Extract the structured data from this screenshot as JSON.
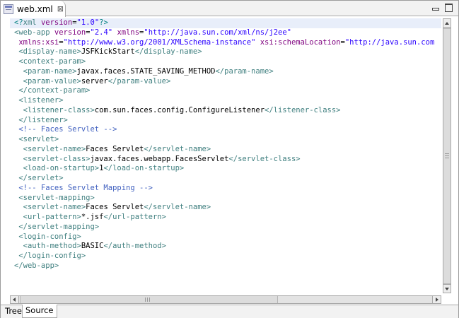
{
  "editor_tab": {
    "title": "web.xml",
    "close_glyph": "⊠",
    "icon": "xml-file-icon"
  },
  "window_controls": {
    "minimize": "minimize-icon",
    "maximize": "maximize-icon"
  },
  "code_lines": [
    [
      [
        "pi",
        "<?"
      ],
      [
        "t",
        "xml "
      ],
      [
        "a",
        "version"
      ],
      [
        "txt",
        "="
      ],
      [
        "v",
        "\"1.0\""
      ],
      [
        "pi",
        "?>"
      ]
    ],
    [
      [
        "t",
        "<web-app "
      ],
      [
        "a",
        "version"
      ],
      [
        "txt",
        "="
      ],
      [
        "v",
        "\"2.4\""
      ],
      [
        "txt",
        " "
      ],
      [
        "a",
        "xmlns"
      ],
      [
        "txt",
        "="
      ],
      [
        "v",
        "\"http://java.sun.com/xml/ns/j2ee\""
      ]
    ],
    [
      [
        "txt",
        " "
      ],
      [
        "a",
        "xmlns:xsi"
      ],
      [
        "txt",
        "="
      ],
      [
        "v",
        "\"http://www.w3.org/2001/XMLSchema-instance\""
      ],
      [
        "txt",
        " "
      ],
      [
        "a",
        "xsi:schemaLocation"
      ],
      [
        "txt",
        "="
      ],
      [
        "v",
        "\"http://java.sun.com"
      ]
    ],
    [
      [
        "t",
        " <display-name>"
      ],
      [
        "txt",
        "JSFKickStart"
      ],
      [
        "t",
        "</display-name>"
      ]
    ],
    [
      [
        "t",
        " <context-param>"
      ]
    ],
    [
      [
        "t",
        "  <param-name>"
      ],
      [
        "txt",
        "javax.faces.STATE_SAVING_METHOD"
      ],
      [
        "t",
        "</param-name>"
      ]
    ],
    [
      [
        "t",
        "  <param-value>"
      ],
      [
        "txt",
        "server"
      ],
      [
        "t",
        "</param-value>"
      ]
    ],
    [
      [
        "t",
        " </context-param>"
      ]
    ],
    [
      [
        "t",
        " <listener>"
      ]
    ],
    [
      [
        "t",
        "  <listener-class>"
      ],
      [
        "txt",
        "com.sun.faces.config.ConfigureListener"
      ],
      [
        "t",
        "</listener-class>"
      ]
    ],
    [
      [
        "t",
        " </listener>"
      ]
    ],
    [
      [
        "c",
        " <!-- Faces Servlet -->"
      ]
    ],
    [
      [
        "t",
        " <servlet>"
      ]
    ],
    [
      [
        "t",
        "  <servlet-name>"
      ],
      [
        "txt",
        "Faces Servlet"
      ],
      [
        "t",
        "</servlet-name>"
      ]
    ],
    [
      [
        "t",
        "  <servlet-class>"
      ],
      [
        "txt",
        "javax.faces.webapp.FacesServlet"
      ],
      [
        "t",
        "</servlet-class>"
      ]
    ],
    [
      [
        "t",
        "  <load-on-startup>"
      ],
      [
        "txt",
        "1"
      ],
      [
        "t",
        "</load-on-startup>"
      ]
    ],
    [
      [
        "t",
        " </servlet>"
      ]
    ],
    [
      [
        "c",
        " <!-- Faces Servlet Mapping -->"
      ]
    ],
    [
      [
        "t",
        " <servlet-mapping>"
      ]
    ],
    [
      [
        "t",
        "  <servlet-name>"
      ],
      [
        "txt",
        "Faces Servlet"
      ],
      [
        "t",
        "</servlet-name>"
      ]
    ],
    [
      [
        "t",
        "  <url-pattern>"
      ],
      [
        "txt",
        "*.jsf"
      ],
      [
        "t",
        "</url-pattern>"
      ]
    ],
    [
      [
        "t",
        " </servlet-mapping>"
      ]
    ],
    [
      [
        "t",
        " <login-config>"
      ]
    ],
    [
      [
        "t",
        "  <auth-method>"
      ],
      [
        "txt",
        "BASIC"
      ],
      [
        "t",
        "</auth-method>"
      ]
    ],
    [
      [
        "t",
        " </login-config>"
      ]
    ],
    [
      [
        "t",
        "</web-app>"
      ]
    ]
  ],
  "bottom_tabs": [
    {
      "label": "Tree",
      "active": false
    },
    {
      "label": "Source",
      "active": true
    }
  ],
  "colors": {
    "tag": "#3f7f7f",
    "attribute": "#7f007f",
    "value": "#2a00ff",
    "comment": "#3f5fbf",
    "current_line": "#e8eefa"
  }
}
